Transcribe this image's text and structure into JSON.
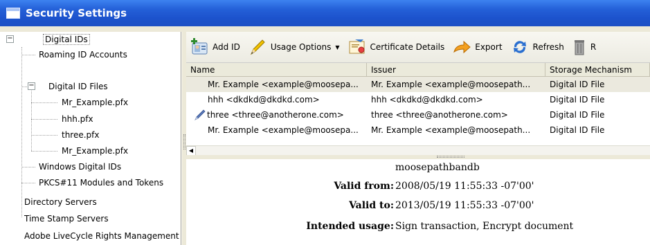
{
  "window": {
    "title": "Security Settings",
    "icon": "window-icon"
  },
  "tree": {
    "items": [
      {
        "label": "Digital IDs",
        "expanded": true,
        "selected": true
      },
      {
        "label": "Roaming ID Accounts"
      },
      {
        "label": "Digital ID Files",
        "expanded": true
      },
      {
        "label": "Mr_Example.pfx"
      },
      {
        "label": "hhh.pfx"
      },
      {
        "label": "three.pfx"
      },
      {
        "label": "Mr_Example.pfx"
      },
      {
        "label": "Windows Digital IDs"
      },
      {
        "label": "PKCS#11 Modules and Tokens"
      },
      {
        "label": "Directory Servers"
      },
      {
        "label": "Time Stamp Servers"
      },
      {
        "label": "Adobe LiveCycle Rights Management"
      }
    ]
  },
  "toolbar": {
    "add_id": "Add ID",
    "usage_options": "Usage Options",
    "certificate_details": "Certificate Details",
    "export": "Export",
    "refresh": "Refresh",
    "remove": "R"
  },
  "list": {
    "columns": [
      "Name",
      "Issuer",
      "Storage Mechanism"
    ],
    "rows": [
      {
        "name": "Mr. Example <example@moosepa...",
        "issuer": "Mr. Example <example@moosepath...",
        "storage": "Digital ID File",
        "selected": true,
        "icon": ""
      },
      {
        "name": "hhh <dkdkd@dkdkd.com>",
        "issuer": "hhh <dkdkd@dkdkd.com>",
        "storage": "Digital ID File",
        "icon": ""
      },
      {
        "name": "three <three@anotherone.com>",
        "issuer": "three <three@anotherone.com>",
        "storage": "Digital ID File",
        "icon": "pen-icon"
      },
      {
        "name": "Mr. Example <example@moosepa...",
        "issuer": "Mr. Example <example@moosepath...",
        "storage": "Digital ID File",
        "icon": ""
      }
    ]
  },
  "details": {
    "subject": "moosepathbandb",
    "valid_from_label": "Valid from:",
    "valid_from": "2008/05/19 11:55:33 -07'00'",
    "valid_to_label": "Valid to:",
    "valid_to": "2013/05/19 11:55:33 -07'00'",
    "usage_label": "Intended usage:",
    "usage": "Sign transaction, Encrypt document"
  },
  "colors": {
    "title_bar": "#2460d8",
    "selected_row": "#ebe9de",
    "window_bg": "#ece9d8"
  }
}
